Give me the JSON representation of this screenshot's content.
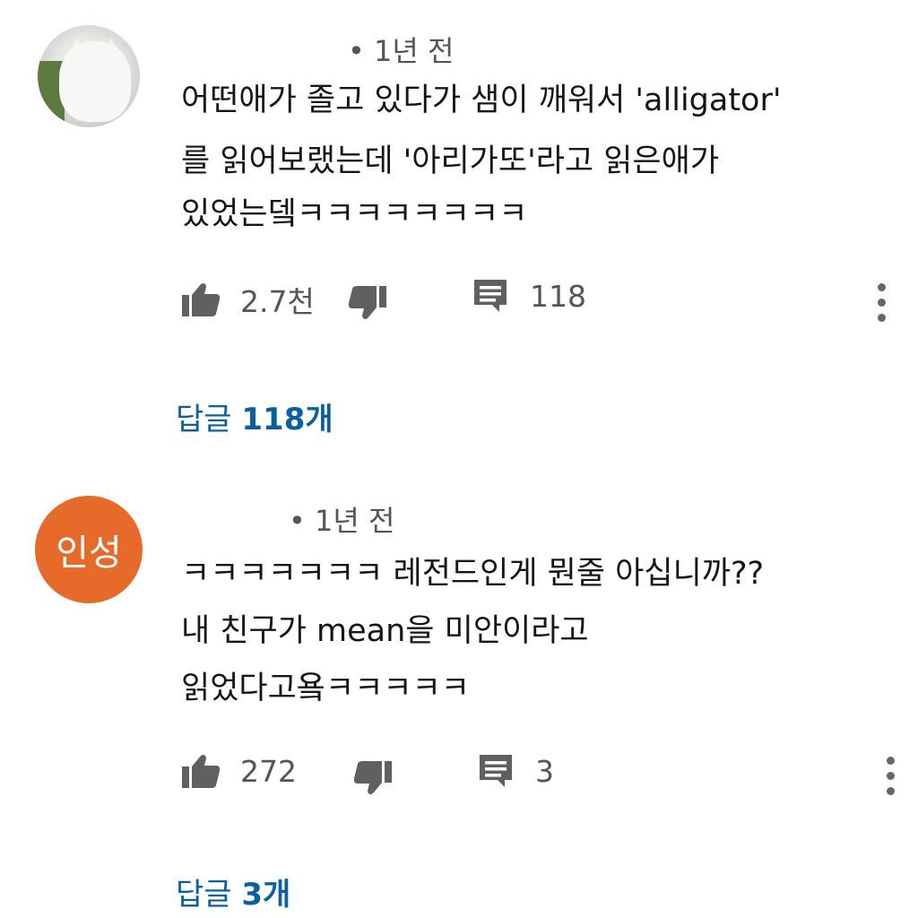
{
  "comments": [
    {
      "timestamp": "• 1년 전",
      "lines": [
        "어떤애가 졸고 있다가 샘이 깨워서 'alligator'",
        "를 읽어보랬는데 '아리가또'라고 읽은애가",
        "있었는뎈ㅋㅋㅋㅋㅋㅋㅋㅋ"
      ],
      "likes": "2.7천",
      "comments_count": "118",
      "replies_label": "답글",
      "replies_count": "118개",
      "avatar_icon": "cat-photo"
    },
    {
      "avatar_text": "인성",
      "timestamp": "• 1년 전",
      "lines": [
        "ㅋㅋㅋㅋㅋㅋㅋ 레전드인게 뭔줄 아십니까??",
        "내 친구가 mean을 미안이라고",
        "읽었다고욬ㅋㅋㅋㅋㅋ"
      ],
      "likes": "272",
      "comments_count": "3",
      "replies_label": "답글",
      "replies_count": "3개",
      "avatar_color": "#e66a2a"
    }
  ],
  "colors": {
    "link": "#0b5f9e",
    "meta": "#555555",
    "icon": "#606060"
  }
}
